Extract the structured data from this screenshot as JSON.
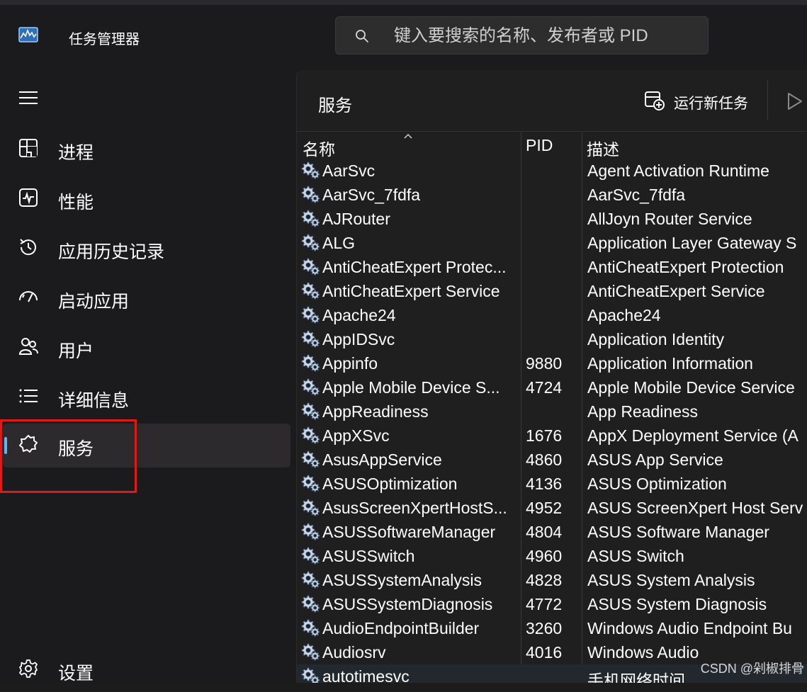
{
  "window": {
    "title": "任务管理器",
    "search_placeholder": "键入要搜索的名称、发布者或 PID"
  },
  "sidebar": {
    "items": [
      {
        "label": "进程",
        "icon": "processes-icon"
      },
      {
        "label": "性能",
        "icon": "performance-icon"
      },
      {
        "label": "应用历史记录",
        "icon": "app-history-icon"
      },
      {
        "label": "启动应用",
        "icon": "startup-apps-icon"
      },
      {
        "label": "用户",
        "icon": "users-icon"
      },
      {
        "label": "详细信息",
        "icon": "details-icon"
      },
      {
        "label": "服务",
        "icon": "services-icon",
        "active": true
      }
    ],
    "settings_label": "设置"
  },
  "main": {
    "title": "服务",
    "run_new_task_label": "运行新任务"
  },
  "table": {
    "columns": [
      "名称",
      "PID",
      "描述"
    ],
    "rows": [
      {
        "name": "AarSvc",
        "pid": "",
        "desc": "Agent Activation Runtime"
      },
      {
        "name": "AarSvc_7fdfa",
        "pid": "",
        "desc": "AarSvc_7fdfa"
      },
      {
        "name": "AJRouter",
        "pid": "",
        "desc": "AllJoyn Router Service"
      },
      {
        "name": "ALG",
        "pid": "",
        "desc": "Application Layer Gateway S"
      },
      {
        "name": "AntiCheatExpert Protec...",
        "pid": "",
        "desc": "AntiCheatExpert Protection"
      },
      {
        "name": "AntiCheatExpert Service",
        "pid": "",
        "desc": "AntiCheatExpert Service"
      },
      {
        "name": "Apache24",
        "pid": "",
        "desc": "Apache24"
      },
      {
        "name": "AppIDSvc",
        "pid": "",
        "desc": "Application Identity"
      },
      {
        "name": "Appinfo",
        "pid": "9880",
        "desc": "Application Information"
      },
      {
        "name": "Apple Mobile Device S...",
        "pid": "4724",
        "desc": "Apple Mobile Device Service"
      },
      {
        "name": "AppReadiness",
        "pid": "",
        "desc": "App Readiness"
      },
      {
        "name": "AppXSvc",
        "pid": "1676",
        "desc": "AppX Deployment Service (A"
      },
      {
        "name": "AsusAppService",
        "pid": "4860",
        "desc": "ASUS App Service"
      },
      {
        "name": "ASUSOptimization",
        "pid": "4136",
        "desc": "ASUS Optimization"
      },
      {
        "name": "AsusScreenXpertHostS...",
        "pid": "4952",
        "desc": "ASUS ScreenXpert Host Serv"
      },
      {
        "name": "ASUSSoftwareManager",
        "pid": "4804",
        "desc": "ASUS Software Manager"
      },
      {
        "name": "ASUSSwitch",
        "pid": "4960",
        "desc": "ASUS Switch"
      },
      {
        "name": "ASUSSystemAnalysis",
        "pid": "4828",
        "desc": "ASUS System Analysis"
      },
      {
        "name": "ASUSSystemDiagnosis",
        "pid": "4772",
        "desc": "ASUS System Diagnosis"
      },
      {
        "name": "AudioEndpointBuilder",
        "pid": "3260",
        "desc": "Windows Audio Endpoint Bu"
      },
      {
        "name": "Audiosrv",
        "pid": "4016",
        "desc": "Windows Audio"
      },
      {
        "name": "autotimesvc",
        "pid": "",
        "desc": "手机网络时间"
      }
    ]
  },
  "watermark": "CSDN @剁椒排骨",
  "colors": {
    "accent": "#63b4f0",
    "highlight_box": "#e01818",
    "background": "#1b1a1c"
  }
}
